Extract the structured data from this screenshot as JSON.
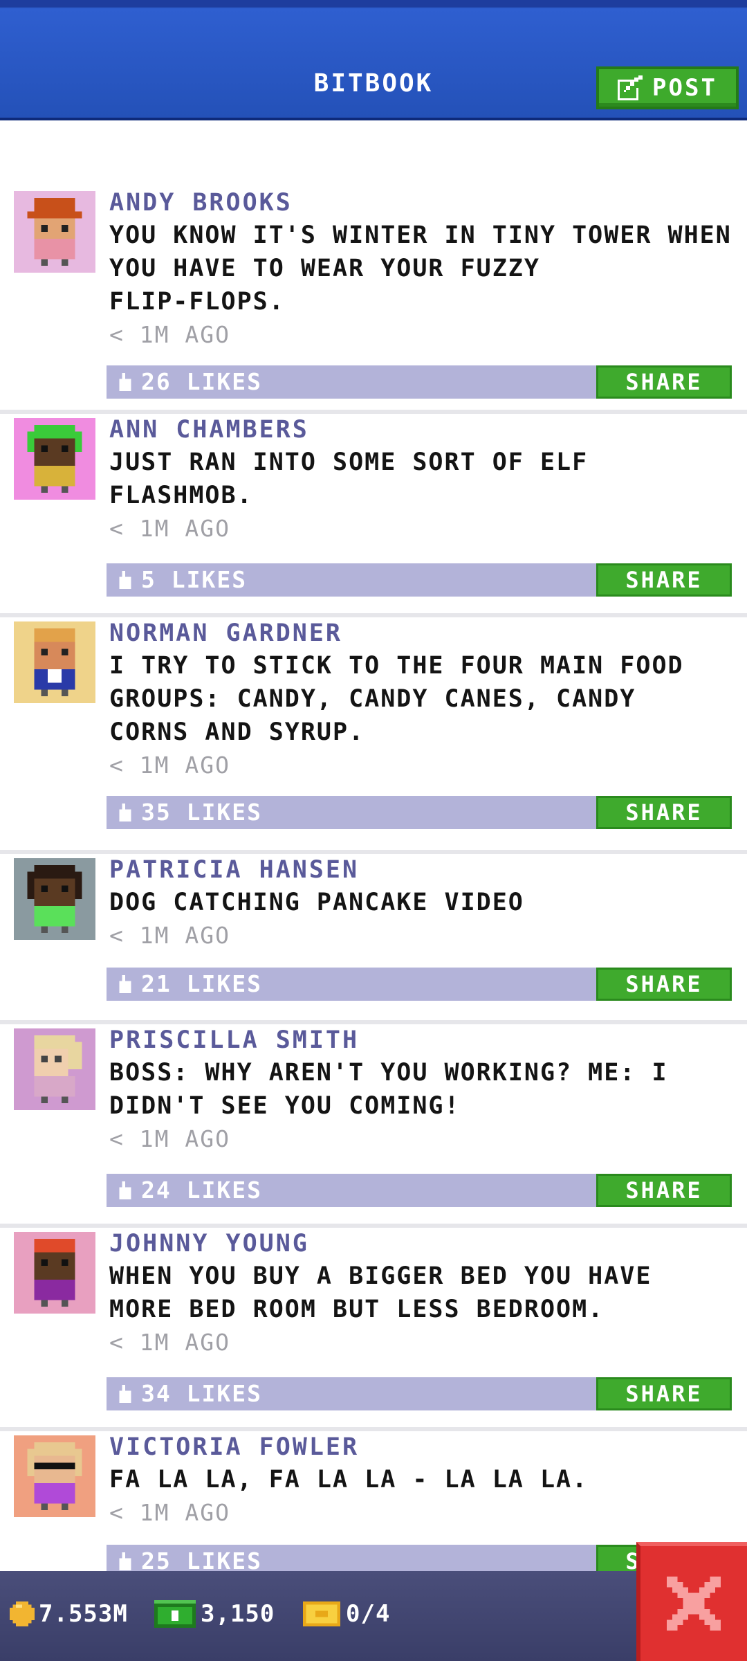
{
  "header": {
    "title": "BITBOOK",
    "post_label": "POST"
  },
  "share_label": "SHARE",
  "posts": [
    {
      "name": "ANDY BROOKS",
      "lines": [
        "YOU KNOW IT'S WINTER IN TINY TOWER WHEN",
        "YOU HAVE TO WEAR YOUR FUZZY",
        "FLIP-FLOPS."
      ],
      "time": "< 1M AGO",
      "likes": "26 LIKES",
      "avatar": {
        "bg": "#e7b9e0",
        "hat": "#c8501a",
        "skin": "#e2a474",
        "shirt": "#e892a6"
      }
    },
    {
      "name": "ANN CHAMBERS",
      "lines": [
        "JUST RAN INTO SOME SORT OF ELF",
        "FLASHMOB."
      ],
      "time": "< 1M AGO",
      "likes": "5 LIKES",
      "avatar": {
        "bg": "#f08ce0",
        "hat": "#3acb3a",
        "skin": "#5a3a22",
        "shirt": "#d8b23a"
      }
    },
    {
      "name": "NORMAN GARDNER",
      "lines": [
        "I TRY TO STICK TO THE FOUR MAIN FOOD",
        "GROUPS: CANDY, CANDY CANES, CANDY",
        "CORNS AND SYRUP."
      ],
      "time": "< 1M AGO",
      "likes": "35 LIKES",
      "avatar": {
        "bg": "#efd38a",
        "hat": "#e2a24a",
        "skin": "#d7895a",
        "shirt": "#2a3aa8"
      }
    },
    {
      "name": "PATRICIA HANSEN",
      "lines": [
        "DOG CATCHING PANCAKE VIDEO"
      ],
      "time": "< 1M AGO",
      "likes": "21 LIKES",
      "avatar": {
        "bg": "#8a9aa0",
        "hat": "#2a1a12",
        "skin": "#5a3a22",
        "shirt": "#5ae05a"
      }
    },
    {
      "name": "PRISCILLA SMITH",
      "lines": [
        "BOSS: WHY AREN'T YOU WORKING? ME: I",
        "DIDN'T SEE YOU COMING!"
      ],
      "time": "< 1M AGO",
      "likes": "24 LIKES",
      "avatar": {
        "bg": "#cf9ad0",
        "hat": "#e8d6a0",
        "skin": "#f0cfae",
        "shirt": "#d8a8c8"
      }
    },
    {
      "name": "JOHNNY YOUNG",
      "lines": [
        "WHEN YOU BUY A BIGGER BED YOU HAVE",
        "MORE BED ROOM BUT LESS BEDROOM."
      ],
      "time": "< 1M AGO",
      "likes": "34 LIKES",
      "avatar": {
        "bg": "#e8a0c0",
        "hat": "#e04a2a",
        "skin": "#5a3a22",
        "shirt": "#8a2aa0"
      }
    },
    {
      "name": "VICTORIA FOWLER",
      "lines": [
        "FA LA LA, FA LA LA - LA LA LA."
      ],
      "time": "< 1M AGO",
      "likes": "25 LIKES",
      "avatar": {
        "bg": "#f0a080",
        "hat": "#e8c890",
        "skin": "#e8b890",
        "shirt": "#b04ad8"
      }
    }
  ],
  "bottom": {
    "coins": "7.553M",
    "bux": "3,150",
    "tickets": "0/4"
  }
}
